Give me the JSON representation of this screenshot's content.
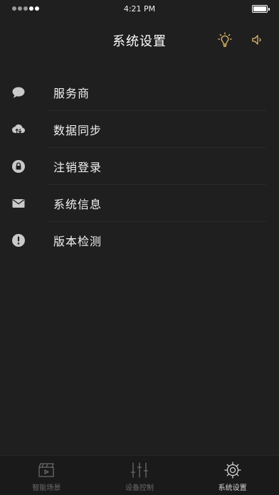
{
  "status_bar": {
    "time": "4:21 PM",
    "signal_bars": 5,
    "signal_strength": 2
  },
  "header": {
    "title": "系统设置",
    "light_icon": "lightbulb-icon",
    "sound_icon": "speaker-icon"
  },
  "menu": {
    "items": [
      {
        "label": "服务商",
        "icon": "chat-bubble-icon"
      },
      {
        "label": "数据同步",
        "icon": "cloud-sync-icon"
      },
      {
        "label": "注销登录",
        "icon": "lock-icon"
      },
      {
        "label": "系统信息",
        "icon": "envelope-icon"
      },
      {
        "label": "版本检测",
        "icon": "alert-icon"
      }
    ]
  },
  "tab_bar": {
    "tabs": [
      {
        "label": "智能场景",
        "icon": "clapperboard-icon",
        "active": false
      },
      {
        "label": "设备控制",
        "icon": "sliders-icon",
        "active": false
      },
      {
        "label": "系统设置",
        "icon": "gear-icon",
        "active": true
      }
    ]
  },
  "colors": {
    "background": "#1f1f1f",
    "accent_icon": "#e0b96a",
    "inactive": "#6b6b6b",
    "active": "#d6d6d6"
  }
}
